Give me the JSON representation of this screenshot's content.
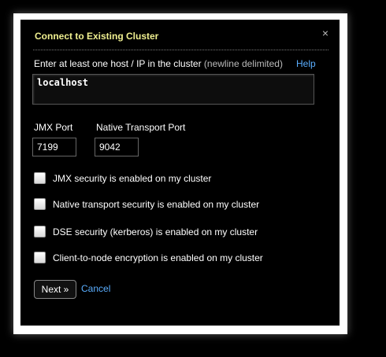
{
  "dialog": {
    "title": "Connect to Existing Cluster",
    "close_icon": "close-icon",
    "close_glyph": "×"
  },
  "hosts": {
    "label": "Enter at least one host / IP in the cluster",
    "hint": "(newline delimited)",
    "help_link": "Help",
    "value": "localhost"
  },
  "ports": {
    "jmx_label": "JMX Port",
    "jmx_value": "7199",
    "native_label": "Native Transport Port",
    "native_value": "9042"
  },
  "checkboxes": [
    {
      "label": "JMX security is enabled on my cluster",
      "checked": false
    },
    {
      "label": "Native transport security is enabled on my cluster",
      "checked": false
    },
    {
      "label": "DSE security (kerberos) is enabled on my cluster",
      "checked": false
    },
    {
      "label": "Client-to-node encryption is enabled on my cluster",
      "checked": false
    }
  ],
  "actions": {
    "next_label": "Next »",
    "cancel_label": "Cancel"
  },
  "colors": {
    "title": "#f0f090",
    "link": "#5aaeff",
    "background": "#000000"
  }
}
